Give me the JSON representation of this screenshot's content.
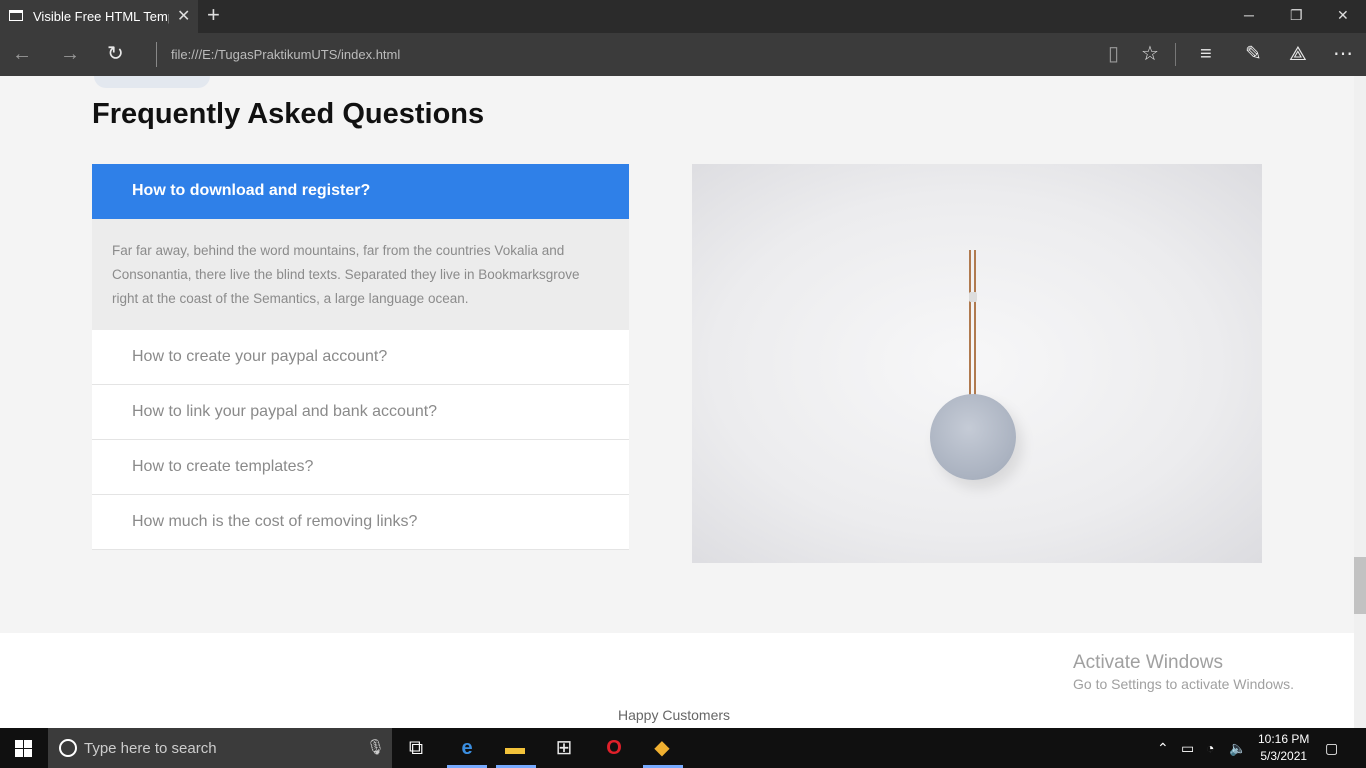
{
  "browser": {
    "tab_title": "Visible Free HTML Temp",
    "address": "file:///E:/TugasPraktikumUTS/index.html",
    "icons": [
      "page-icon",
      "close-icon",
      "new-tab-icon",
      "minimize-icon",
      "maximize-icon",
      "close-window-icon",
      "back-icon",
      "forward-icon",
      "refresh-icon",
      "reading-view-icon",
      "favorite-star-icon",
      "hub-icon",
      "notes-icon",
      "share-icon",
      "more-icon"
    ]
  },
  "page": {
    "faq_title": "Frequently Asked Questions",
    "faq": [
      {
        "question": "How to download and register?",
        "active": true,
        "answer": "Far far away, behind the word mountains, far from the countries Vokalia and Consonantia, there live the blind texts. Separated they live in Bookmarksgrove right at the coast of the Semantics, a large language ocean."
      },
      {
        "question": "How to create your paypal account?"
      },
      {
        "question": "How to link your paypal and bank account?"
      },
      {
        "question": "How to create templates?"
      },
      {
        "question": "How much is the cost of removing links?"
      }
    ],
    "happy_customers": "Happy Customers",
    "accent": "#2f80e8"
  },
  "watermark": {
    "line1": "Activate Windows",
    "line2": "Go to Settings to activate Windows."
  },
  "taskbar": {
    "search_placeholder": "Type here to search",
    "time": "10:16 PM",
    "date": "5/3/2021"
  }
}
